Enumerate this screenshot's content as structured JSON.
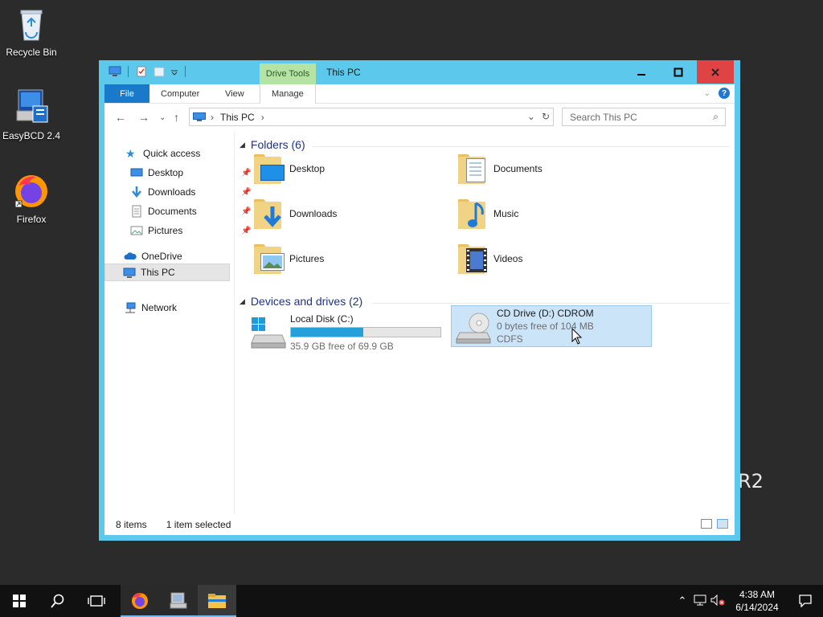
{
  "desktop": {
    "icons": [
      {
        "label": "Recycle Bin"
      },
      {
        "label": "EasyBCD 2.4"
      },
      {
        "label": "Firefox"
      }
    ],
    "watermark_fragment": "R2"
  },
  "window": {
    "title": "This PC",
    "context_tab": "Drive Tools",
    "ribbon_tabs": {
      "file": "File",
      "computer": "Computer",
      "view": "View",
      "manage": "Manage"
    },
    "address": {
      "location": "This PC"
    },
    "search": {
      "placeholder": "Search This PC"
    },
    "sidebar": {
      "quick_access": "Quick access",
      "items": [
        {
          "label": "Desktop",
          "pinned": true
        },
        {
          "label": "Downloads",
          "pinned": true
        },
        {
          "label": "Documents",
          "pinned": true
        },
        {
          "label": "Pictures",
          "pinned": true
        }
      ],
      "onedrive": "OneDrive",
      "this_pc": "This PC",
      "network": "Network"
    },
    "folders_group": {
      "title": "Folders (6)"
    },
    "folders": [
      {
        "name": "Desktop"
      },
      {
        "name": "Documents"
      },
      {
        "name": "Downloads"
      },
      {
        "name": "Music"
      },
      {
        "name": "Pictures"
      },
      {
        "name": "Videos"
      }
    ],
    "devices_group": {
      "title": "Devices and drives (2)"
    },
    "drives": [
      {
        "name": "Local Disk (C:)",
        "free_text": "35.9 GB free of 69.9 GB",
        "used_fraction": 0.486
      },
      {
        "name": "CD Drive (D:) CDROM",
        "free_text": "0 bytes free of 104 MB",
        "fs": "CDFS"
      }
    ],
    "status": {
      "items": "8 items",
      "selected": "1 item selected"
    }
  },
  "taskbar": {
    "clock": {
      "time": "4:38 AM",
      "date": "6/14/2024"
    }
  },
  "colors": {
    "accent": "#1979ca",
    "window_frame": "#5bc8ec",
    "selection": "#cce4f7",
    "drive_bar": "#26a0da"
  }
}
